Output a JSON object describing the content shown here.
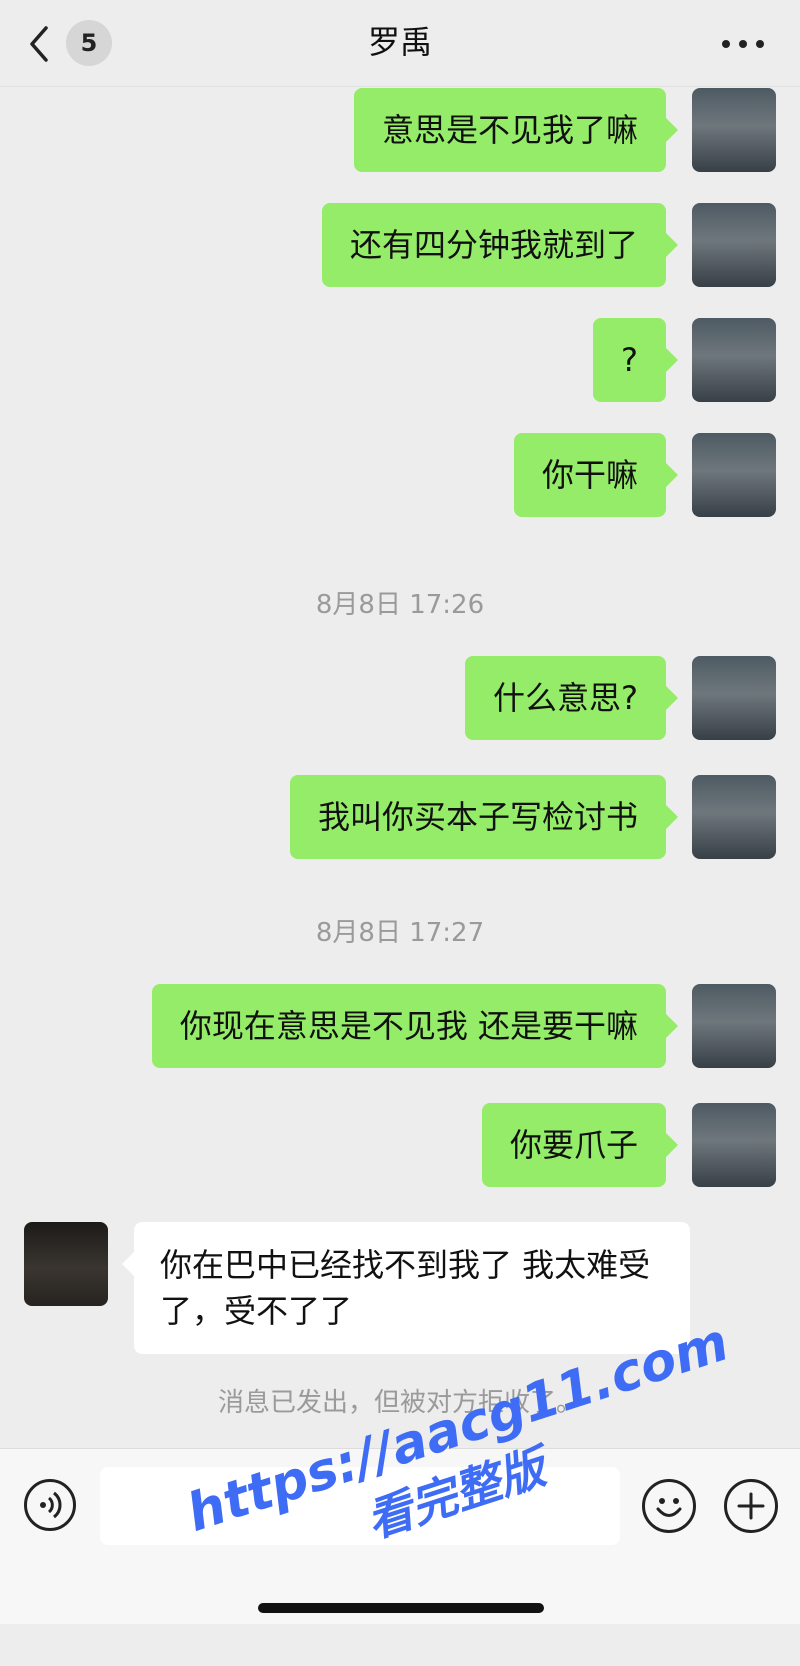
{
  "header": {
    "back_badge": "5",
    "title": "罗禹"
  },
  "messages": [
    {
      "from": "me",
      "text": "意思是不见我了嘛"
    },
    {
      "from": "me",
      "text": "还有四分钟我就到了"
    },
    {
      "from": "me",
      "text": "?"
    },
    {
      "from": "me",
      "text": "你干嘛"
    },
    {
      "timestamp": "8月8日 17:26"
    },
    {
      "from": "me",
      "text": "什么意思?"
    },
    {
      "from": "me",
      "text": "我叫你买本子写检讨书"
    },
    {
      "timestamp": "8月8日 17:27"
    },
    {
      "from": "me",
      "text": "你现在意思是不见我 还是要干嘛"
    },
    {
      "from": "me",
      "text": "你要爪子"
    },
    {
      "from": "them",
      "text": "你在巴中已经找不到我了 我太难受了，受不了了"
    }
  ],
  "notice": "消息已发出，但被对方拒收了。",
  "input": {
    "value": ""
  },
  "watermark": {
    "url": "https://aacg11.com",
    "subtitle": "看完整版",
    "color": "#3f6cf5"
  },
  "colors": {
    "background": "#ededed",
    "my_bubble": "#95ec69",
    "their_bubble": "#ffffff",
    "meta_text": "#9a9a9a"
  },
  "icons": [
    "back-chevron-icon",
    "more-icon",
    "voice-icon",
    "emoji-icon",
    "plus-icon"
  ]
}
